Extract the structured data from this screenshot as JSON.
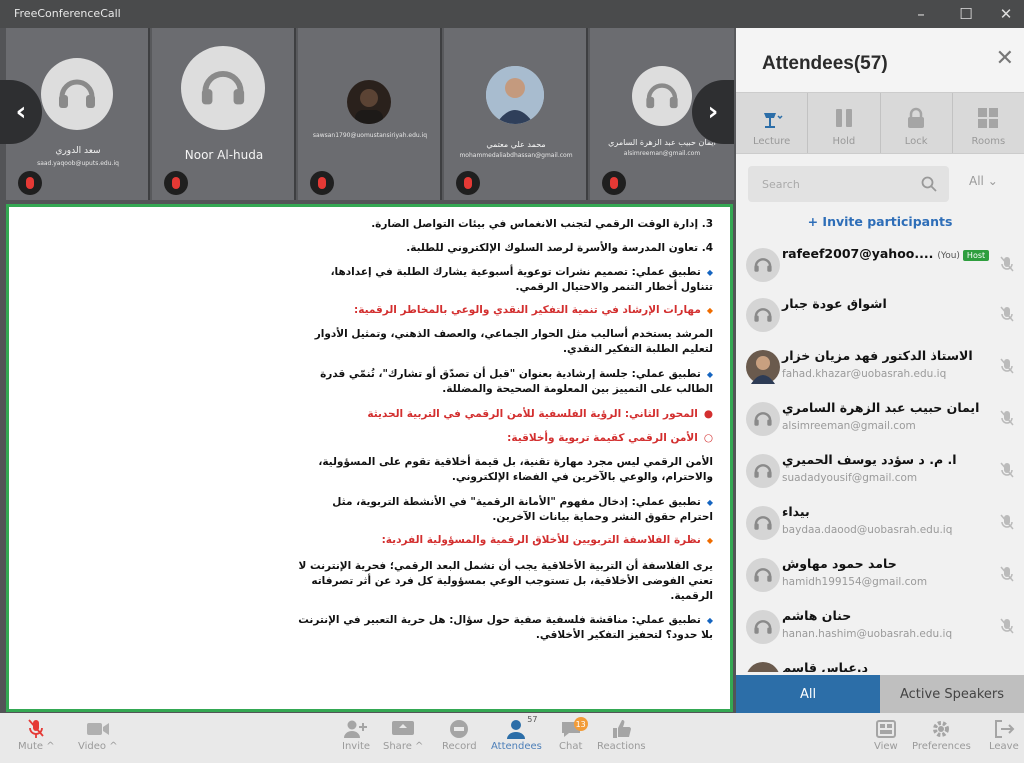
{
  "window": {
    "title": "FreeConferenceCall"
  },
  "tiles": [
    {
      "name": "سعد الدوري",
      "email": "saad.yaqoob@uputs.edu.iq",
      "avatar": "headset"
    },
    {
      "name": "Noor Al-huda",
      "email": "",
      "avatar": "headset"
    },
    {
      "name": "",
      "email": "sawsan1790@uomustansiriyah.edu.iq",
      "avatar": "photo"
    },
    {
      "name": "محمد علي معتمي",
      "email": "mohammedaliabdhassan@gmail.com",
      "avatar": "photo"
    },
    {
      "name": "ايمان حبيب عبد الزهرة السامري",
      "email": "alsimreeman@gmail.com",
      "avatar": "headset"
    }
  ],
  "document": {
    "lines": [
      "3. إدارة الوقت الرقمي لتجنب الانغماس في بيئات التواصل الضارة.",
      "4. تعاون المدرسة والأسرة لرصد السلوك الإلكتروني للطلبة.",
      "تطبيق عملي: تصميم نشرات توعوية أسبوعية يشارك الطلبة في إعدادها،",
      "تتناول أخطار التنمر والاحتيال الرقمي.",
      "مهارات الإرشاد في تنمية التفكير النقدي والوعي بالمخاطر الرقمية:",
      "المرشد يستخدم أساليب مثل الحوار الجماعي، والعصف الذهني، وتمثيل الأدوار",
      "لتعليم الطلبة التفكير النقدي.",
      "تطبيق عملي: جلسة إرشادية بعنوان \"قبل أن تصدّق أو تشارك\"، تُنمّي قدرة",
      "الطالب على التمييز بين المعلومة الصحيحة والمضللة.",
      "المحور الثاني: الرؤية الفلسفية للأمن الرقمي في التربية الحديثة",
      "الأمن الرقمي كقيمة تربوية وأخلاقية:",
      "الأمن الرقمي ليس مجرد مهارة تقنية، بل قيمة أخلاقية تقوم على المسؤولية،",
      "والاحترام، والوعي بالآخرين في الفضاء الإلكتروني.",
      "تطبيق عملي: إدخال مفهوم \"الأمانة الرقمية\" في الأنشطة التربوية، مثل",
      "احترام حقوق النشر وحماية بيانات الآخرين.",
      "نظرة الفلاسفة التربويين للأخلاق الرقمية والمسؤولية الفردية:",
      "يرى الفلاسفة أن التربية الأخلاقية يجب أن تشمل البعد الرقمي؛ فحرية الإنترنت لا",
      "تعني الفوضى الأخلاقية، بل تستوجب الوعي بمسؤولية كل فرد عن أثر تصرفاته",
      "الرقمية.",
      "تطبيق عملي: مناقشة فلسفية صفية حول سؤال: هل حرية التعبير في الإنترنت",
      "بلا حدود؟ لتحفيز التفكير الأخلاقي."
    ]
  },
  "attendees_panel": {
    "title": "Attendees(57)",
    "tools": [
      "Lecture",
      "Hold",
      "Lock",
      "Rooms"
    ],
    "search_placeholder": "Search",
    "filter": "All",
    "invite": "+ Invite participants",
    "you_label": "(You)",
    "host_label": "Host",
    "attendees": [
      {
        "name": "rafeef2007@yahoo....",
        "email": "",
        "photo": false
      },
      {
        "name": "اشواق عودة جبار",
        "email": "",
        "photo": false
      },
      {
        "name": "الاستاذ الدكتور فهد مزيان خزار",
        "email": "fahad.khazar@uobasrah.edu.iq",
        "photo": true
      },
      {
        "name": "ايمان حبيب عبد الزهرة السامري",
        "email": "alsimreeman@gmail.com",
        "photo": false
      },
      {
        "name": "ا. م. د سؤدد يوسف الحميري",
        "email": "suadadyousif@gmail.com",
        "photo": false
      },
      {
        "name": "بيداء",
        "email": "baydaa.daood@uobasrah.edu.iq",
        "photo": false
      },
      {
        "name": "حامد حمود مهاوش",
        "email": "hamidh199154@gmail.com",
        "photo": false
      },
      {
        "name": "حنان هاشم",
        "email": "hanan.hashim@uobasrah.edu.iq",
        "photo": false
      },
      {
        "name": "د.عباس قاسم",
        "email": "",
        "photo": true
      }
    ],
    "tabs": [
      "All",
      "Active Speakers"
    ]
  },
  "bottombar": {
    "left": [
      "Mute ^",
      "Video ^"
    ],
    "center": [
      "Invite",
      "Share ^",
      "Record",
      "Attendees",
      "Chat",
      "Reactions"
    ],
    "attendee_count": "57",
    "chat_count": "13",
    "right": [
      "View",
      "Preferences",
      "Leave"
    ]
  },
  "colors": {
    "accent": "#2c6ea8",
    "active_border": "#34a853",
    "muted": "#e53935",
    "host_badge": "#2e9e3e"
  }
}
